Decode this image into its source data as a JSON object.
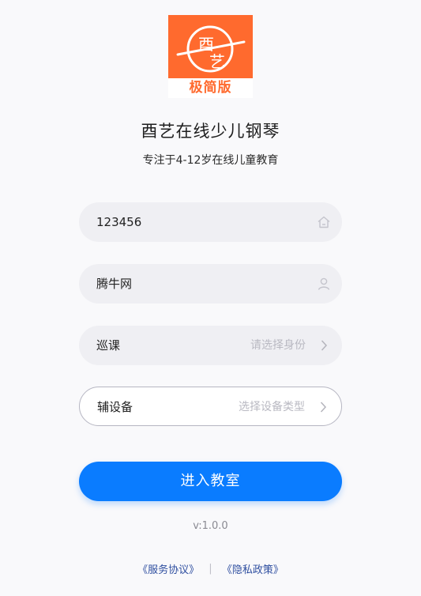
{
  "logo": {
    "glyphs": "酉艺",
    "badge_text": "极简版",
    "brand_color": "#ff6a2e"
  },
  "app": {
    "title": "酉艺在线少儿钢琴",
    "subtitle": "专注于4-12岁在线儿童教育"
  },
  "form": {
    "room_field": {
      "value": "123456",
      "icon": "home-icon"
    },
    "name_field": {
      "value": "腾牛网",
      "icon": "user-icon"
    },
    "role_field": {
      "value": "巡课",
      "placeholder": "请选择身份",
      "icon": "chevron-right-icon"
    },
    "device_field": {
      "value": "辅设备",
      "placeholder": "选择设备类型",
      "icon": "chevron-right-icon"
    }
  },
  "enter_button": {
    "label": "进入教室",
    "color": "#0a7cff"
  },
  "version": "v:1.0.0",
  "footer": {
    "service_agreement": "《服务协议》",
    "separator": "|",
    "privacy_policy": "《隐私政策》"
  }
}
